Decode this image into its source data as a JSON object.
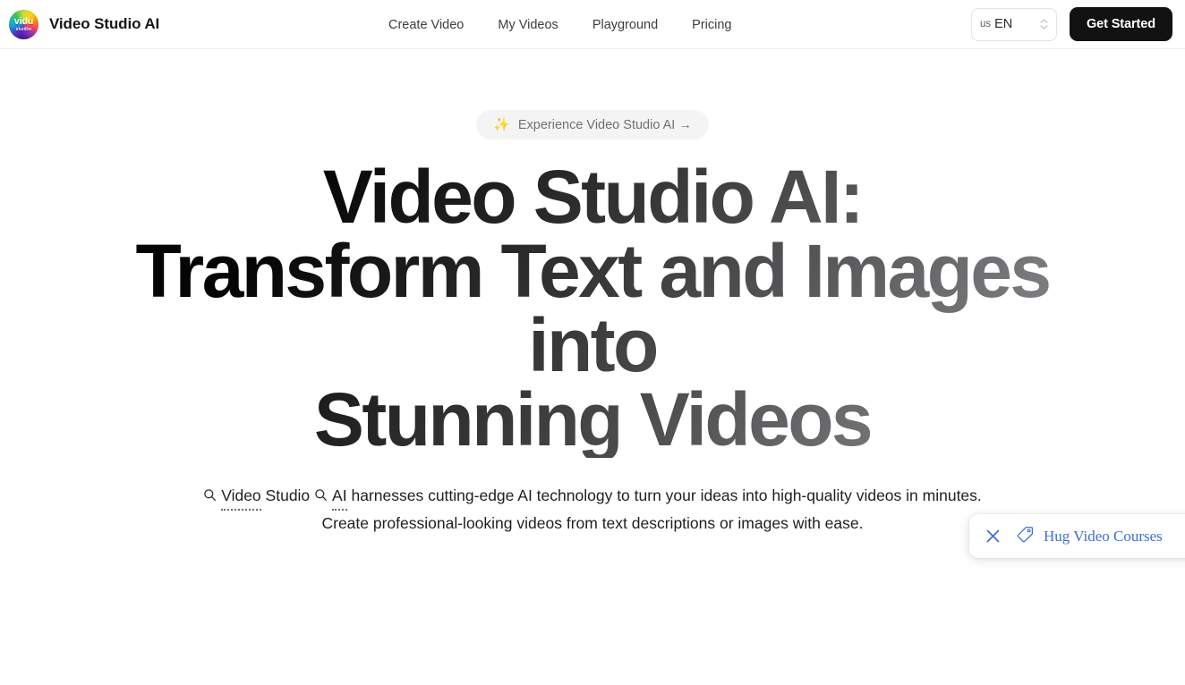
{
  "header": {
    "brand": {
      "logo_main": "vidu",
      "logo_sub": "studio",
      "name": "Video Studio AI",
      "logo_icon": "vidu-studio-logo"
    },
    "nav": [
      {
        "label": "Create Video"
      },
      {
        "label": "My Videos"
      },
      {
        "label": "Playground"
      },
      {
        "label": "Pricing"
      }
    ],
    "language": {
      "country": "us",
      "code": "EN"
    },
    "cta": {
      "label": "Get Started"
    }
  },
  "hero": {
    "badge": {
      "icon": "✨",
      "text": "Experience Video Studio AI →"
    },
    "headline_line1": "Video Studio AI:",
    "headline_line2": "Transform Text and Images into",
    "headline_line3": "Stunning Videos",
    "subtitle": {
      "term1": "Video",
      "mid1": "Studio",
      "term2": "AI",
      "rest1": "harnesses cutting-edge AI technology to turn your ideas into high-quality videos in minutes.",
      "line2": "Create professional-looking videos from text descriptions or images with ease."
    }
  },
  "toast": {
    "close_icon": "close-icon",
    "tag_icon": "tag-icon",
    "label": "Hug Video Courses"
  },
  "colors": {
    "accent_dark": "#121212",
    "toast_blue": "#3c6fd2",
    "pill_bg": "#f4f4f5",
    "muted_text": "#6f6f75"
  }
}
